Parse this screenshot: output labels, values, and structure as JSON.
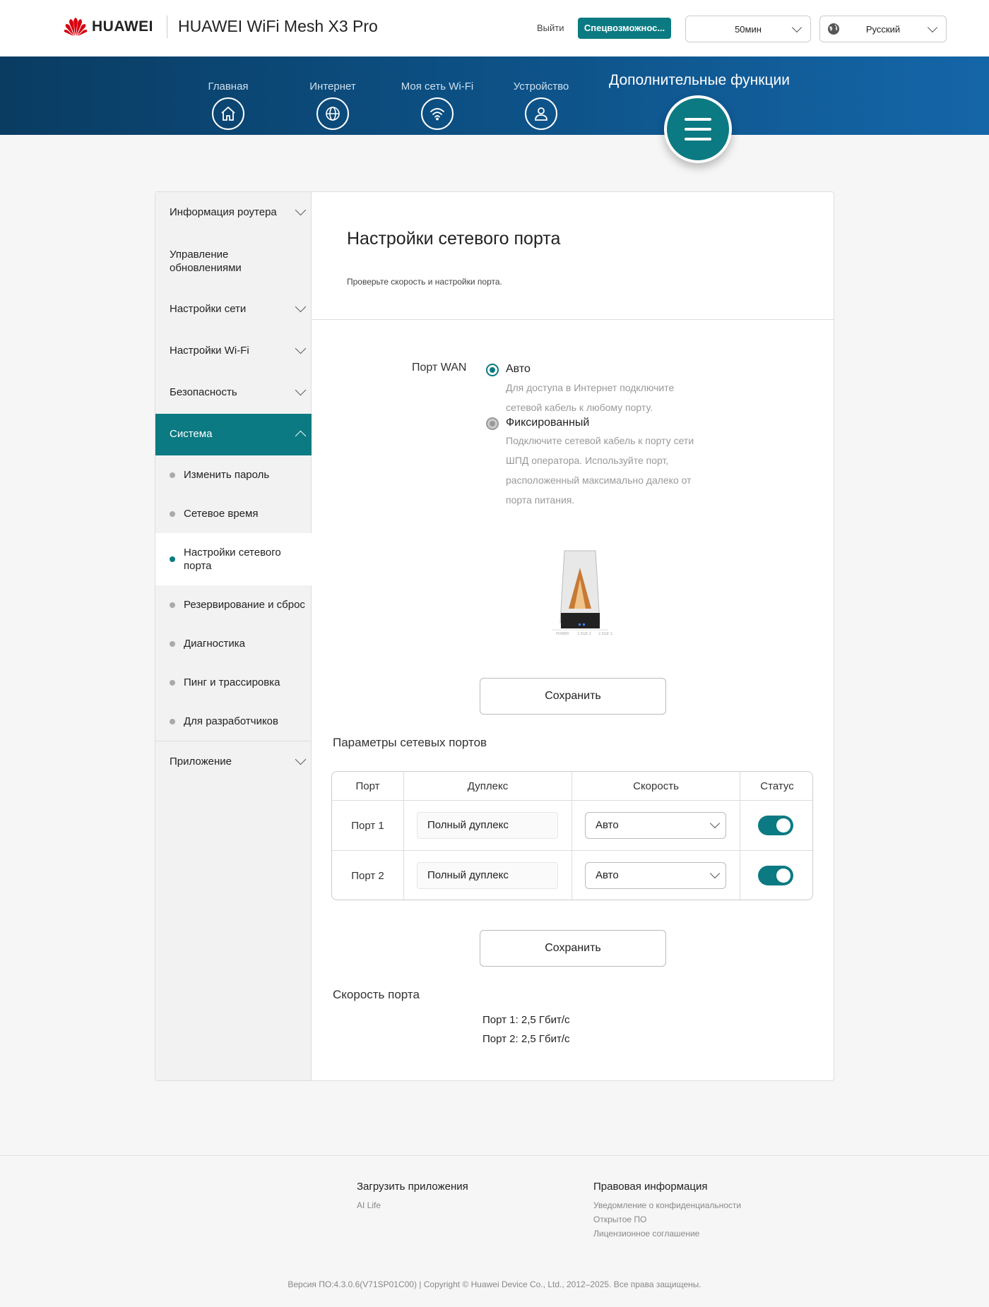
{
  "header": {
    "brand": "HUAWEI",
    "product": "HUAWEI WiFi Mesh X3 Pro",
    "logout": "Выйти",
    "accessibility": "Спецвозможнос...",
    "timeout": "50мин",
    "language": "Русский"
  },
  "nav": {
    "home": "Главная",
    "internet": "Интернет",
    "wifi": "Моя сеть Wi-Fi",
    "devices": "Устройство",
    "advanced": "Дополнительные функции"
  },
  "sidebar": {
    "router_info": "Информация роутера",
    "updates": "Управление обновлениями",
    "network": "Настройки сети",
    "wifi": "Настройки Wi-Fi",
    "security": "Безопасность",
    "system": "Система",
    "sub": {
      "password": "Изменить пароль",
      "time": "Сетевое время",
      "port": "Настройки сетевого порта",
      "backup": "Резервирование и сброс",
      "diagnostics": "Диагностика",
      "ping": "Пинг и трассировка",
      "developers": "Для разработчиков"
    },
    "apps": "Приложение"
  },
  "main": {
    "title": "Настройки сетевого порта",
    "description": "Проверьте скорость и настройки порта.",
    "wan_label": "Порт WAN",
    "auto_title": "Авто",
    "auto_desc": "Для доступа в Интернет подключите сетевой кабель к любому порту.",
    "fixed_title": "Фиксированный",
    "fixed_desc": "Подключите сетевой кабель к порту сети ШПД оператора. Используйте порт, расположенный максимально далеко от порта питания.",
    "device_ports": [
      "POWER",
      "2.5GE 2",
      "2.5GE 1"
    ],
    "save": "Сохранить",
    "params_title": "Параметры сетевых портов",
    "table": {
      "headers": [
        "Порт",
        "Дуплекс",
        "Скорость",
        "Статус"
      ],
      "rows": [
        {
          "port": "Порт 1",
          "duplex": "Полный дуплекс",
          "speed": "Авто",
          "status": true
        },
        {
          "port": "Порт 2",
          "duplex": "Полный дуплекс",
          "speed": "Авто",
          "status": true
        }
      ]
    },
    "speed_title": "Скорость порта",
    "speeds": [
      {
        "label": "Порт 1:",
        "value": "2,5 Гбит/с"
      },
      {
        "label": "Порт 2:",
        "value": "2,5 Гбит/с"
      }
    ]
  },
  "footer": {
    "apps_title": "Загрузить приложения",
    "ai_life": "AI Life",
    "legal_title": "Правовая информация",
    "privacy": "Уведомление о конфиденциальности",
    "open_source": "Открытое ПО",
    "license": "Лицензионное соглашение",
    "copyright": "Версия ПО:4.3.0.6(V71SP01C00) | Copyright © Huawei Device Co., Ltd., 2012–2025. Все права защищены."
  },
  "colors": {
    "accent": "#0b7a82",
    "nav_dark": "#0a3c62",
    "nav_light": "#1566a8",
    "logo_red": "#d7000f"
  }
}
